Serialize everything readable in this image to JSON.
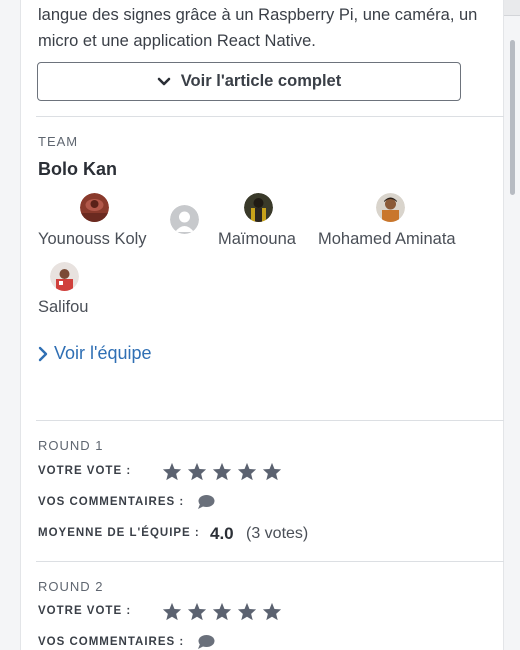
{
  "intro": {
    "text": "langue des signes grâce à un Raspberry Pi, une caméra, un micro et une application React Native."
  },
  "article_button": {
    "label": "Voir l'article complet",
    "icon": "chevron-down-icon"
  },
  "team": {
    "section_label": "TEAM",
    "name": "Bolo Kan",
    "members": [
      {
        "name": "Younouss Koly",
        "avatar": "photo"
      },
      {
        "name": "",
        "avatar": "default-user-icon"
      },
      {
        "name": "Maïmouna",
        "avatar": "photo"
      },
      {
        "name": "Mohamed Aminata",
        "avatar": "photo"
      },
      {
        "name": "Salifou",
        "avatar": "photo"
      }
    ],
    "see_team_label": "Voir l'équipe"
  },
  "rounds": [
    {
      "label": "ROUND 1",
      "vote_label": "VOTRE VOTE :",
      "stars": 5,
      "comments_label": "VOS COMMENTAIRES :",
      "average_label": "MOYENNE DE L'ÉQUIPE :",
      "average_value": "4.0",
      "votes_text": "(3 votes)"
    },
    {
      "label": "ROUND 2",
      "vote_label": "VOTRE VOTE :",
      "stars": 5,
      "comments_label": "VOS COMMENTAIRES :"
    }
  ],
  "colors": {
    "accent_link": "#2f6fb4",
    "star": "#5b6270",
    "text": "#2b2f36"
  }
}
